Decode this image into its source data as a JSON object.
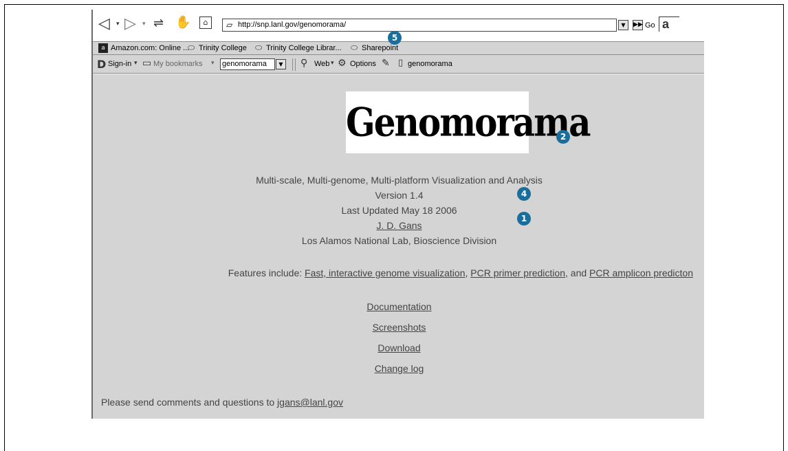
{
  "toolbar": {
    "url": "http://snp.lanl.gov/genomorama/",
    "go_label": "Go"
  },
  "bookmarks": [
    "Amazon.com: Online ...",
    "Trinity College",
    "Trinity College Librar...",
    "Sharepoint"
  ],
  "search_toolbar": {
    "signin": "Sign-in",
    "my_bookmarks": "My bookmarks",
    "search_value": "genomorama",
    "web": "Web",
    "options": "Options",
    "tab_label": "genomorama"
  },
  "page": {
    "logo_text": "Genomorama",
    "subtitle": "Multi-scale, Multi-genome, Multi-platform Visualization and Analysis",
    "version": "Version 1.4",
    "updated": "Last Updated May 18 2006",
    "author": "J. D. Gans",
    "org": "Los Alamos National Lab, Bioscience Division",
    "features_prefix": "Features include:",
    "feature_1": "Fast, interactive genome visualization",
    "feature_2": "PCR primer prediction",
    "feature_sep": ", and",
    "feature_3": "PCR amplicon predicton",
    "links": [
      "Documentation",
      "Screenshots",
      "Download",
      "Change log"
    ],
    "comments_prefix": "Please send comments and questions to",
    "email": "jgans@lanl.gov"
  },
  "badges": [
    "5",
    "2",
    "4",
    "1"
  ]
}
